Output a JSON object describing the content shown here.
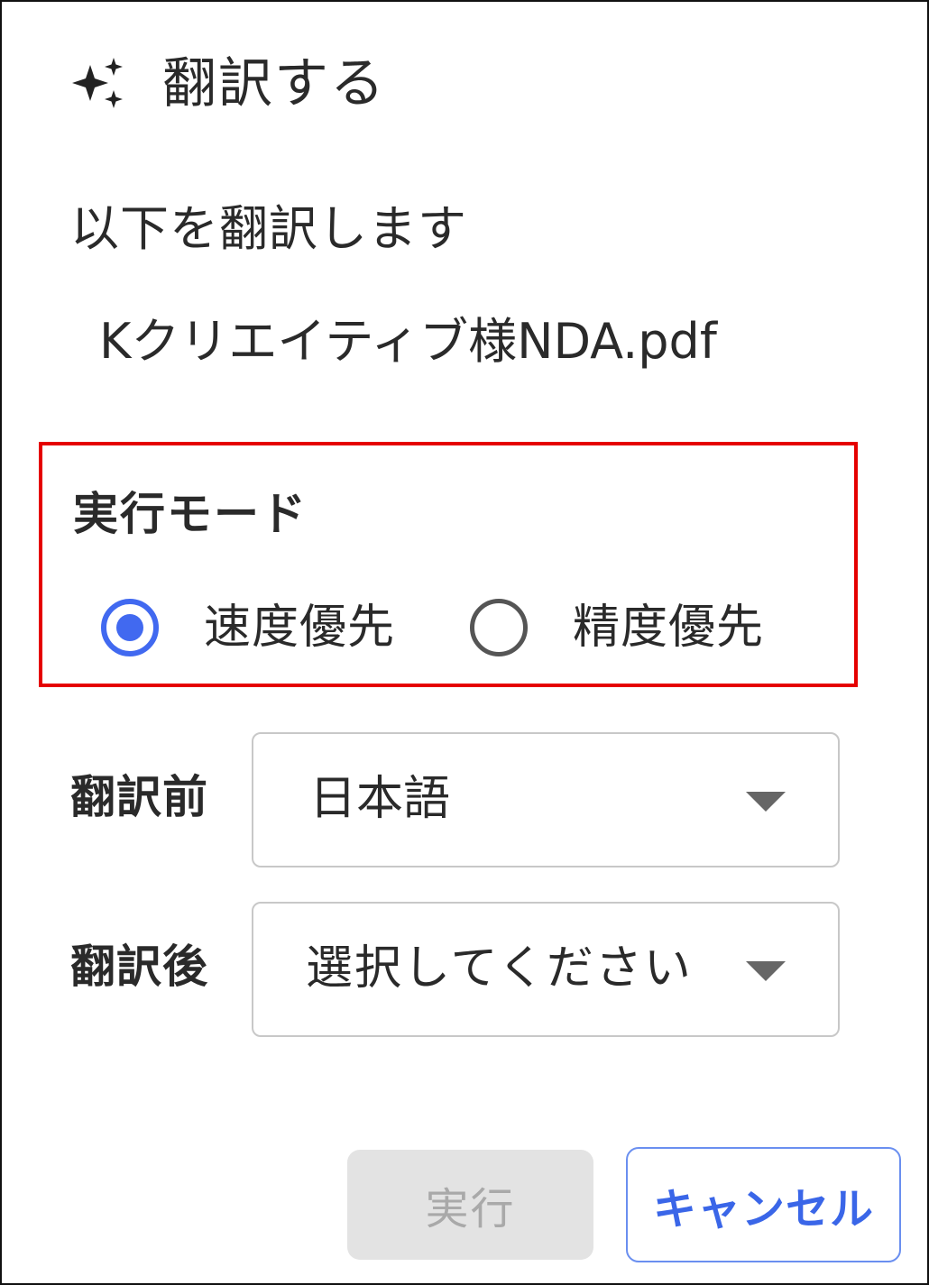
{
  "dialog": {
    "title": "翻訳する",
    "subtitle": "以下を翻訳します",
    "filename": "Kクリエイティブ様NDA.pdf"
  },
  "mode": {
    "label": "実行モード",
    "options": [
      {
        "label": "速度優先",
        "selected": true
      },
      {
        "label": "精度優先",
        "selected": false
      }
    ],
    "highlight_color": "#e50000",
    "accent_color": "#4169f0"
  },
  "source_lang": {
    "label": "翻訳前",
    "value": "日本語"
  },
  "target_lang": {
    "label": "翻訳後",
    "placeholder": "選択してください"
  },
  "buttons": {
    "run": "実行",
    "cancel": "キャンセル"
  },
  "icons": {
    "title": "sparkle-icon",
    "dropdown": "chevron-down-icon"
  }
}
